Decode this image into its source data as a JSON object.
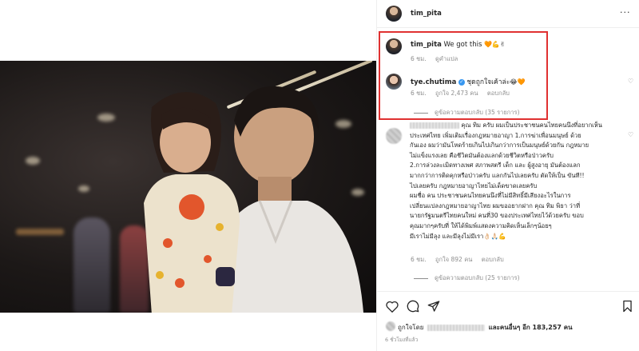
{
  "post": {
    "author": "tim_pita",
    "more_label": "···"
  },
  "caption": {
    "username": "tim_pita",
    "text": "We got this",
    "emojis": "🧡💪✌",
    "time": "6 ชม.",
    "translate": "ดูคำแปล"
  },
  "reply1": {
    "username": "tye.chutima",
    "verified_icon": "verified-badge-icon",
    "text": "ชุดถูกใจเค้าล่ะ",
    "emojis": "😂🧡",
    "time": "6 ชม.",
    "likes": "ถูกใจ 2,473 คน",
    "reply": "ตอบกลับ",
    "view_replies": "ดูข้อความตอบกลับ (35 รายการ)"
  },
  "comment2": {
    "lines": [
      "คุณ ทิม ครับ ผมเป็นประชาชนคนไทยคนนึงที่อยากเห็น",
      "ประเทศไทย เพิ่มเติมเรื่องกฎหมายอาญา 1.การฆ่าเพื่อนมนุษย์ ด้วย",
      "กันเอง ผมว่ามันโหดร้ายเกินไปเกินกว่าการเป็นมนุษย์ด้วยกัน กฎหมาย",
      "ไม่แข็งแรงเลย คือชีวิตมันต้องแลกด้วยชีวิตหรือป่าวครับ",
      "2.การล่วงละเมิดทางเพศ สภาพสตรี เด็ก และ ผู้สูงอายุ มันต้องแลก",
      "มากกว่าการติดคุกหรือป่าวครับ แลกกันไปเลยครับ ตัดให้เป็น ขันที!!",
      "ไปเลยครับ กฎหมายอาญาไทยไม่เด็ดขาดเลยครับ",
      "ผมชื่อ คน ประชาชนคนไทยคนนึงที่ไม่มีสิทธิ์มีเสียงอะไรในการ",
      "เปลี่ยนแปลงกฎหมายอาญาไทย ผมขออยากฝาก คุณ ทิม พิธา ว่าที่",
      "นายกรัฐมนตรีไทยคนใหม่ คนที่30 ของประเทศไทยไว้ด้วยครับ ขอบ",
      "คุณมากๆครับที่ ให้ได้พิมพ์แสดงความคิดเห็นเล็กๆน้อยๆ",
      "มีเราไม่มีลุง และมีลุงไม่มีเรา👌🏻🙏🏻💪"
    ],
    "time": "6 ชม.",
    "likes": "ถูกใจ 892 คน",
    "reply": "ตอบกลับ",
    "view_replies": "ดูข้อความตอบกลับ (25 รายการ)"
  },
  "actions": {
    "like_icon": "heart-icon",
    "comment_icon": "comment-icon",
    "share_icon": "send-icon",
    "save_icon": "bookmark-icon"
  },
  "likes_summary": {
    "prefix": "ถูกใจโดย",
    "suffix": "และคนอื่นๆ อีก 183,257 คน"
  },
  "posted_ago": "6 ชั่วโมงที่แล้ว",
  "colors": {
    "highlight": "#e03131",
    "muted": "#8e8e8e",
    "verified": "#3897f0"
  }
}
